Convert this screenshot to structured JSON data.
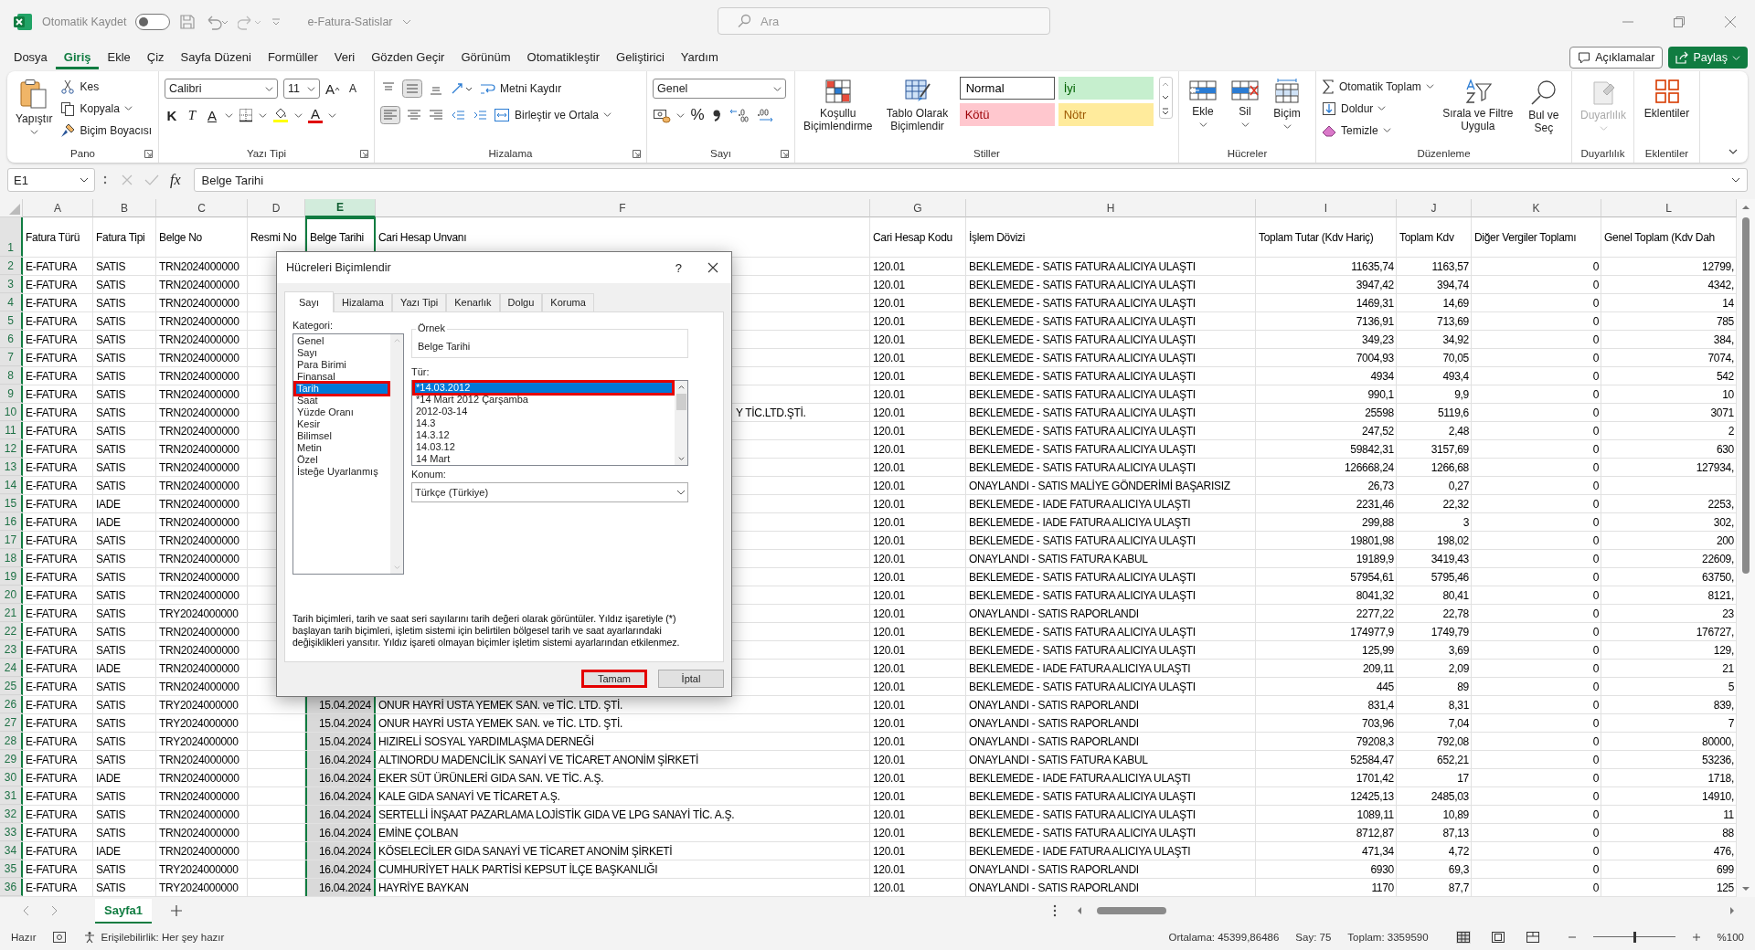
{
  "title_bar": {
    "autosave_label": "Otomatik Kaydet",
    "autosave_on": false,
    "file_name": "e-Fatura-Satislar",
    "search_placeholder": "Ara"
  },
  "menu": {
    "tabs": [
      {
        "label": "Dosya",
        "selected": false
      },
      {
        "label": "Giriş",
        "selected": true
      },
      {
        "label": "Ekle",
        "selected": false
      },
      {
        "label": "Çiz",
        "selected": false
      },
      {
        "label": "Sayfa Düzeni",
        "selected": false
      },
      {
        "label": "Formüller",
        "selected": false
      },
      {
        "label": "Veri",
        "selected": false
      },
      {
        "label": "Gözden Geçir",
        "selected": false
      },
      {
        "label": "Görünüm",
        "selected": false
      },
      {
        "label": "Otomatikleştir",
        "selected": false
      },
      {
        "label": "Geliştirici",
        "selected": false
      },
      {
        "label": "Yardım",
        "selected": false
      }
    ],
    "comments_button": "Açıklamalar",
    "share_button": "Paylaş"
  },
  "ribbon": {
    "clipboard": {
      "title": "Pano",
      "paste": "Yapıştır",
      "cut": "Kes",
      "copy": "Kopyala",
      "format_painter": "Biçim Boyacısı"
    },
    "font": {
      "title": "Yazı Tipi",
      "family": "Calibri",
      "size": "11",
      "grow": "A",
      "shrink": "A",
      "bold": "K",
      "italic": "T",
      "underline": "A",
      "font_color_letter": "A"
    },
    "alignment": {
      "title": "Hizalama",
      "wrap": "Metni Kaydır",
      "merge": "Birleştir ve Ortala"
    },
    "number": {
      "title": "Sayı",
      "format": "Genel",
      "percent": "%"
    },
    "styles": {
      "title": "Stiller",
      "conditional": "Koşullu Biçimlendirme",
      "as_table": "Tablo Olarak Biçimlendir",
      "gallery": [
        {
          "label": "Normal",
          "kind": "normal"
        },
        {
          "label": "İyi",
          "kind": "good"
        },
        {
          "label": "Kötü",
          "kind": "bad"
        },
        {
          "label": "Nötr",
          "kind": "neutral"
        }
      ]
    },
    "cells": {
      "title": "Hücreler",
      "insert": "Ekle",
      "delete": "Sil",
      "format": "Biçim"
    },
    "editing": {
      "title": "Düzenleme",
      "autosum": "Otomatik Toplam",
      "fill": "Doldur",
      "clear": "Temizle",
      "sort": "Sırala ve Filtre Uygula",
      "find": "Bul ve Seç"
    },
    "sensitivity": {
      "title": "Duyarlılık",
      "button": "Duyarlılık",
      "disabled": true
    },
    "addins": {
      "title": "Eklentiler",
      "button": "Eklentiler"
    }
  },
  "formula_bar": {
    "name_box": "E1",
    "function_label": "fx",
    "value": "Belge Tarihi"
  },
  "sheet": {
    "columns": [
      {
        "letter": "A",
        "selected": false
      },
      {
        "letter": "B",
        "selected": false
      },
      {
        "letter": "C",
        "selected": false
      },
      {
        "letter": "D",
        "selected": false
      },
      {
        "letter": "E",
        "selected": true
      },
      {
        "letter": "F",
        "selected": false
      },
      {
        "letter": "G",
        "selected": false
      },
      {
        "letter": "H",
        "selected": false
      },
      {
        "letter": "I",
        "selected": false
      },
      {
        "letter": "J",
        "selected": false
      },
      {
        "letter": "K",
        "selected": false
      },
      {
        "letter": "L",
        "selected": false
      }
    ],
    "rows": [
      {
        "row": "1",
        "kind": "header",
        "cells": [
          "Fatura Türü",
          "Fatura Tipi",
          "Belge No",
          "Resmi No",
          "Belge Tarihi",
          "Cari Hesap Unvanı",
          "Cari Hesap Kodu",
          "İşlem Dövizi",
          "Toplam Tutar (Kdv Hariç)",
          "Toplam Kdv",
          "Diğer Vergiler Toplamı",
          "Genel Toplam  (Kdv Dah"
        ]
      },
      {
        "row": "2",
        "kind": "data",
        "cells": [
          "E-FATURA",
          "SATIS",
          "TRN2024000000",
          null,
          null,
          null,
          "120.01",
          "BEKLEMEDE - SATIS FATURA ALICIYA ULAŞTI",
          "11635,74",
          "1163,57",
          "0",
          "12799,"
        ]
      },
      {
        "row": "3",
        "kind": "data",
        "cells": [
          "E-FATURA",
          "SATIS",
          "TRN2024000000",
          null,
          null,
          null,
          "120.01",
          "BEKLEMEDE - SATIS FATURA ALICIYA ULAŞTI",
          "3947,42",
          "394,74",
          "0",
          "4342,"
        ]
      },
      {
        "row": "4",
        "kind": "data",
        "cells": [
          "E-FATURA",
          "SATIS",
          "TRN2024000000",
          null,
          null,
          null,
          "120.01",
          "BEKLEMEDE - SATIS FATURA ALICIYA ULAŞTI",
          "1469,31",
          "14,69",
          "0",
          "14"
        ]
      },
      {
        "row": "5",
        "kind": "data",
        "cells": [
          "E-FATURA",
          "SATIS",
          "TRN2024000000",
          null,
          null,
          null,
          "120.01",
          "BEKLEMEDE - SATIS FATURA ALICIYA ULAŞTI",
          "7136,91",
          "713,69",
          "0",
          "785"
        ]
      },
      {
        "row": "6",
        "kind": "data",
        "cells": [
          "E-FATURA",
          "SATIS",
          "TRN2024000000",
          null,
          null,
          null,
          "120.01",
          "BEKLEMEDE - SATIS FATURA ALICIYA ULAŞTI",
          "349,23",
          "34,92",
          "0",
          "384,"
        ]
      },
      {
        "row": "7",
        "kind": "data",
        "cells": [
          "E-FATURA",
          "SATIS",
          "TRN2024000000",
          null,
          null,
          null,
          "120.01",
          "BEKLEMEDE - SATIS FATURA ALICIYA ULAŞTI",
          "7004,93",
          "70,05",
          "0",
          "7074,"
        ]
      },
      {
        "row": "8",
        "kind": "data",
        "cells": [
          "E-FATURA",
          "SATIS",
          "TRN2024000000",
          null,
          null,
          null,
          "120.01",
          "BEKLEMEDE - SATIS FATURA ALICIYA ULAŞTI",
          "4934",
          "493,4",
          "0",
          "542"
        ]
      },
      {
        "row": "9",
        "kind": "data",
        "cells": [
          "E-FATURA",
          "SATIS",
          "TRN2024000000",
          null,
          null,
          null,
          "120.01",
          "BEKLEMEDE - SATIS FATURA ALICIYA ULAŞTI",
          "990,1",
          "9,9",
          "0",
          "10"
        ]
      },
      {
        "row": "10",
        "kind": "data",
        "cells": [
          "E-FATURA",
          "SATIS",
          "TRN2024000000",
          null,
          null,
          "Y TİC.LTD.ŞTİ.",
          "120.01",
          "BEKLEMEDE - SATIS FATURA ALICIYA ULAŞTI",
          "25598",
          "5119,6",
          "0",
          "3071"
        ]
      },
      {
        "row": "11",
        "kind": "data",
        "cells": [
          "E-FATURA",
          "SATIS",
          "TRN2024000000",
          null,
          null,
          null,
          "120.01",
          "BEKLEMEDE - SATIS FATURA ALICIYA ULAŞTI",
          "247,52",
          "2,48",
          "0",
          "2"
        ]
      },
      {
        "row": "12",
        "kind": "data",
        "cells": [
          "E-FATURA",
          "SATIS",
          "TRN2024000000",
          null,
          null,
          null,
          "120.01",
          "BEKLEMEDE - SATIS FATURA ALICIYA ULAŞTI",
          "59842,31",
          "3157,69",
          "0",
          "630"
        ]
      },
      {
        "row": "13",
        "kind": "data",
        "cells": [
          "E-FATURA",
          "SATIS",
          "TRN2024000000",
          null,
          null,
          null,
          "120.01",
          "BEKLEMEDE - SATIS FATURA ALICIYA ULAŞTI",
          "126668,24",
          "1266,68",
          "0",
          "127934,"
        ]
      },
      {
        "row": "14",
        "kind": "data",
        "cells": [
          "E-FATURA",
          "SATIS",
          "TRN2024000000",
          null,
          null,
          null,
          "120.01",
          "ONAYLANDI - SATIS MALİYE GÖNDERİMİ BAŞARISIZ",
          "26,73",
          "0,27",
          "0",
          null
        ]
      },
      {
        "row": "15",
        "kind": "data",
        "cells": [
          "E-FATURA",
          "IADE",
          "TRN2024000000",
          null,
          null,
          null,
          "120.01",
          "BEKLEMEDE - IADE FATURA ALICIYA ULAŞTI",
          "2231,46",
          "22,32",
          "0",
          "2253,"
        ]
      },
      {
        "row": "16",
        "kind": "data",
        "cells": [
          "E-FATURA",
          "IADE",
          "TRN2024000000",
          null,
          null,
          null,
          "120.01",
          "BEKLEMEDE - IADE FATURA ALICIYA ULAŞTI",
          "299,88",
          "3",
          "0",
          "302,"
        ]
      },
      {
        "row": "17",
        "kind": "data",
        "cells": [
          "E-FATURA",
          "SATIS",
          "TRN2024000000",
          null,
          null,
          null,
          "120.01",
          "BEKLEMEDE - SATIS FATURA ALICIYA ULAŞTI",
          "19801,98",
          "198,02",
          "0",
          "200"
        ]
      },
      {
        "row": "18",
        "kind": "data",
        "cells": [
          "E-FATURA",
          "SATIS",
          "TRN2024000000",
          null,
          null,
          null,
          "120.01",
          "ONAYLANDI - SATIS FATURA KABUL",
          "19189,9",
          "3419,43",
          "0",
          "22609,"
        ]
      },
      {
        "row": "19",
        "kind": "data",
        "cells": [
          "E-FATURA",
          "SATIS",
          "TRN2024000000",
          null,
          null,
          null,
          "120.01",
          "BEKLEMEDE - SATIS FATURA ALICIYA ULAŞTI",
          "57954,61",
          "5795,46",
          "0",
          "63750,"
        ]
      },
      {
        "row": "20",
        "kind": "data",
        "cells": [
          "E-FATURA",
          "SATIS",
          "TRN2024000000",
          null,
          null,
          null,
          "120.01",
          "BEKLEMEDE - SATIS FATURA ALICIYA ULAŞTI",
          "8041,32",
          "80,41",
          "0",
          "8121,"
        ]
      },
      {
        "row": "21",
        "kind": "data",
        "cells": [
          "E-FATURA",
          "SATIS",
          "TRY2024000000",
          null,
          null,
          null,
          "120.01",
          "ONAYLANDI - SATIS RAPORLANDI",
          "2277,22",
          "22,78",
          "0",
          "23"
        ]
      },
      {
        "row": "22",
        "kind": "data",
        "cells": [
          "E-FATURA",
          "SATIS",
          "TRN2024000000",
          null,
          null,
          null,
          "120.01",
          "BEKLEMEDE - SATIS FATURA ALICIYA ULAŞTI",
          "174977,9",
          "1749,79",
          "0",
          "176727,"
        ]
      },
      {
        "row": "23",
        "kind": "data",
        "cells": [
          "E-FATURA",
          "SATIS",
          "TRN2024000000",
          null,
          null,
          null,
          "120.01",
          "BEKLEMEDE - SATIS FATURA ALICIYA ULAŞTI",
          "125,99",
          "3,69",
          "0",
          "129,"
        ]
      },
      {
        "row": "24",
        "kind": "data",
        "cells": [
          "E-FATURA",
          "IADE",
          "TRN2024000000",
          null,
          null,
          null,
          "120.01",
          "BEKLEMEDE - IADE FATURA ALICIYA ULAŞTI",
          "209,11",
          "2,09",
          "0",
          "21"
        ]
      },
      {
        "row": "25",
        "kind": "data",
        "cells": [
          "E-FATURA",
          "SATIS",
          "TRN2024000000",
          null,
          null,
          null,
          "120.01",
          "BEKLEMEDE - SATIS FATURA ALICIYA ULAŞTI",
          "445",
          "89",
          "0",
          "5"
        ]
      },
      {
        "row": "26",
        "kind": "data",
        "cells": [
          "E-FATURA",
          "SATIS",
          "TRY2024000000",
          null,
          "15.04.2024",
          "ONUR HAYRİ USTA YEMEK SAN. ve TİC. LTD. ŞTİ.",
          "120.01",
          "ONAYLANDI - SATIS RAPORLANDI",
          "831,4",
          "8,31",
          "0",
          "839,"
        ]
      },
      {
        "row": "27",
        "kind": "data",
        "cells": [
          "E-FATURA",
          "SATIS",
          "TRY2024000000",
          null,
          "15.04.2024",
          "ONUR HAYRİ USTA YEMEK SAN. ve TİC. LTD. ŞTİ.",
          "120.01",
          "ONAYLANDI - SATIS RAPORLANDI",
          "703,96",
          "7,04",
          "0",
          "7"
        ]
      },
      {
        "row": "28",
        "kind": "data",
        "cells": [
          "E-FATURA",
          "SATIS",
          "TRY2024000000",
          null,
          "15.04.2024",
          "HIZIRELİ SOSYAL YARDIMLAŞMA DERNEĞİ",
          "120.01",
          "ONAYLANDI - SATIS RAPORLANDI",
          "79208,3",
          "792,08",
          "0",
          "80000,"
        ]
      },
      {
        "row": "29",
        "kind": "data",
        "cells": [
          "E-FATURA",
          "SATIS",
          "TRN2024000000",
          null,
          "16.04.2024",
          "ALTINORDU MADENCİLİK SANAYİ VE TİCARET ANONİM ŞİRKETİ",
          "120.01",
          "ONAYLANDI - SATIS FATURA KABUL",
          "52584,47",
          "652,21",
          "0",
          "53236,"
        ]
      },
      {
        "row": "30",
        "kind": "data",
        "cells": [
          "E-FATURA",
          "IADE",
          "TRN2024000000",
          null,
          "16.04.2024",
          "EKER SÜT ÜRÜNLERİ GIDA SAN. VE TİC. A.Ş.",
          "120.01",
          "BEKLEMEDE - IADE FATURA ALICIYA ULAŞTI",
          "1701,42",
          "17",
          "0",
          "1718,"
        ]
      },
      {
        "row": "31",
        "kind": "data",
        "cells": [
          "E-FATURA",
          "SATIS",
          "TRN2024000000",
          null,
          "16.04.2024",
          "KALE GIDA SANAYİ VE TİCARET A.Ş.",
          "120.01",
          "BEKLEMEDE - SATIS FATURA ALICIYA ULAŞTI",
          "12425,13",
          "2485,03",
          "0",
          "14910,"
        ]
      },
      {
        "row": "32",
        "kind": "data",
        "cells": [
          "E-FATURA",
          "SATIS",
          "TRN2024000000",
          null,
          "16.04.2024",
          "SERTELLİ İNŞAAT PAZARLAMA LOJİSTİK GIDA VE LPG SANAYİ TİC. A.Ş.",
          "120.01",
          "BEKLEMEDE - SATIS FATURA ALICIYA ULAŞTI",
          "1089,11",
          "10,89",
          "0",
          "11"
        ]
      },
      {
        "row": "33",
        "kind": "data",
        "cells": [
          "E-FATURA",
          "SATIS",
          "TRN2024000000",
          null,
          "16.04.2024",
          "EMİNE ÇOLBAN",
          "120.01",
          "BEKLEMEDE - SATIS FATURA ALICIYA ULAŞTI",
          "8712,87",
          "87,13",
          "0",
          "88"
        ]
      },
      {
        "row": "34",
        "kind": "data",
        "cells": [
          "E-FATURA",
          "IADE",
          "TRN2024000000",
          null,
          "16.04.2024",
          "KÖSELECİLER GIDA SANAYİ VE TİCARET ANONİM ŞİRKETİ",
          "120.01",
          "BEKLEMEDE - IADE FATURA ALICIYA ULAŞTI",
          "471,34",
          "4,72",
          "0",
          "476,"
        ]
      },
      {
        "row": "35",
        "kind": "data",
        "cells": [
          "E-FATURA",
          "SATIS",
          "TRY2024000000",
          null,
          "16.04.2024",
          "CUMHURİYET HALK PARTİSİ KEPSUT İLÇE BAŞKANLIĞI",
          "120.01",
          "ONAYLANDI - SATIS RAPORLANDI",
          "6930",
          "69,3",
          "0",
          "699"
        ]
      },
      {
        "row": "36",
        "kind": "data",
        "cells": [
          "E-FATURA",
          "SATIS",
          "TRY2024000000",
          null,
          "16.04.2024",
          "HAYRİYE BAYKAN",
          "120.01",
          "ONAYLANDI - SATIS RAPORLANDI",
          "1170",
          "87,7",
          "0",
          "125"
        ]
      }
    ]
  },
  "dialog": {
    "title": "Hücreleri Biçimlendir",
    "help": "?",
    "tabs": [
      {
        "label": "Sayı",
        "selected": true
      },
      {
        "label": "Hizalama",
        "selected": false
      },
      {
        "label": "Yazı Tipi",
        "selected": false
      },
      {
        "label": "Kenarlık",
        "selected": false
      },
      {
        "label": "Dolgu",
        "selected": false
      },
      {
        "label": "Koruma",
        "selected": false
      }
    ],
    "category_label": "Kategori:",
    "categories": [
      {
        "label": "Genel",
        "selected": false,
        "annotated": false
      },
      {
        "label": "Sayı",
        "selected": false,
        "annotated": false
      },
      {
        "label": "Para Birimi",
        "selected": false,
        "annotated": false
      },
      {
        "label": "Finansal",
        "selected": false,
        "annotated": false
      },
      {
        "label": "Tarih",
        "selected": true,
        "annotated": true
      },
      {
        "label": "Saat",
        "selected": false,
        "annotated": false
      },
      {
        "label": "Yüzde Oranı",
        "selected": false,
        "annotated": false
      },
      {
        "label": "Kesir",
        "selected": false,
        "annotated": false
      },
      {
        "label": "Bilimsel",
        "selected": false,
        "annotated": false
      },
      {
        "label": "Metin",
        "selected": false,
        "annotated": false
      },
      {
        "label": "Özel",
        "selected": false,
        "annotated": false
      },
      {
        "label": "İsteğe Uyarlanmış",
        "selected": false,
        "annotated": false
      }
    ],
    "sample_label": "Örnek",
    "sample_value": "Belge Tarihi",
    "type_label": "Tür:",
    "types": [
      {
        "label": "*14.03.2012",
        "selected": true,
        "annotated": true
      },
      {
        "label": "*14 Mart 2012 Çarşamba",
        "selected": false,
        "annotated": false
      },
      {
        "label": "2012-03-14",
        "selected": false,
        "annotated": false
      },
      {
        "label": "14.3",
        "selected": false,
        "annotated": false
      },
      {
        "label": "14.3.12",
        "selected": false,
        "annotated": false
      },
      {
        "label": "14.03.12",
        "selected": false,
        "annotated": false
      },
      {
        "label": "14 Mart",
        "selected": false,
        "annotated": false
      }
    ],
    "locale_label": "Konum:",
    "locale": "Türkçe (Türkiye)",
    "description": "Tarih biçimleri, tarih ve saat seri sayılarını tarih değeri olarak görüntüler. Yıldız işaretiyle (*) başlayan tarih biçimleri, işletim sistemi için belirtilen bölgesel tarih ve saat ayarlarındaki değişiklikleri yansıtır. Yıldız işareti olmayan biçimler işletim sistemi ayarlarından etkilenmez.",
    "buttons": [
      {
        "label": "Tamam",
        "annotated": true
      },
      {
        "label": "İptal",
        "annotated": false
      }
    ]
  },
  "sheet_tabs": [
    {
      "label": "Sayfa1",
      "selected": true
    }
  ],
  "status_bar": {
    "ready": "Hazır",
    "accessibility": "Erişilebilirlik: Her şey hazır",
    "average": "Ortalama: 45399,86486",
    "count": "Say: 75",
    "sum": "Toplam: 3359590",
    "zoom": "%100",
    "zoom_slider": {
      "level": 0.5
    }
  }
}
